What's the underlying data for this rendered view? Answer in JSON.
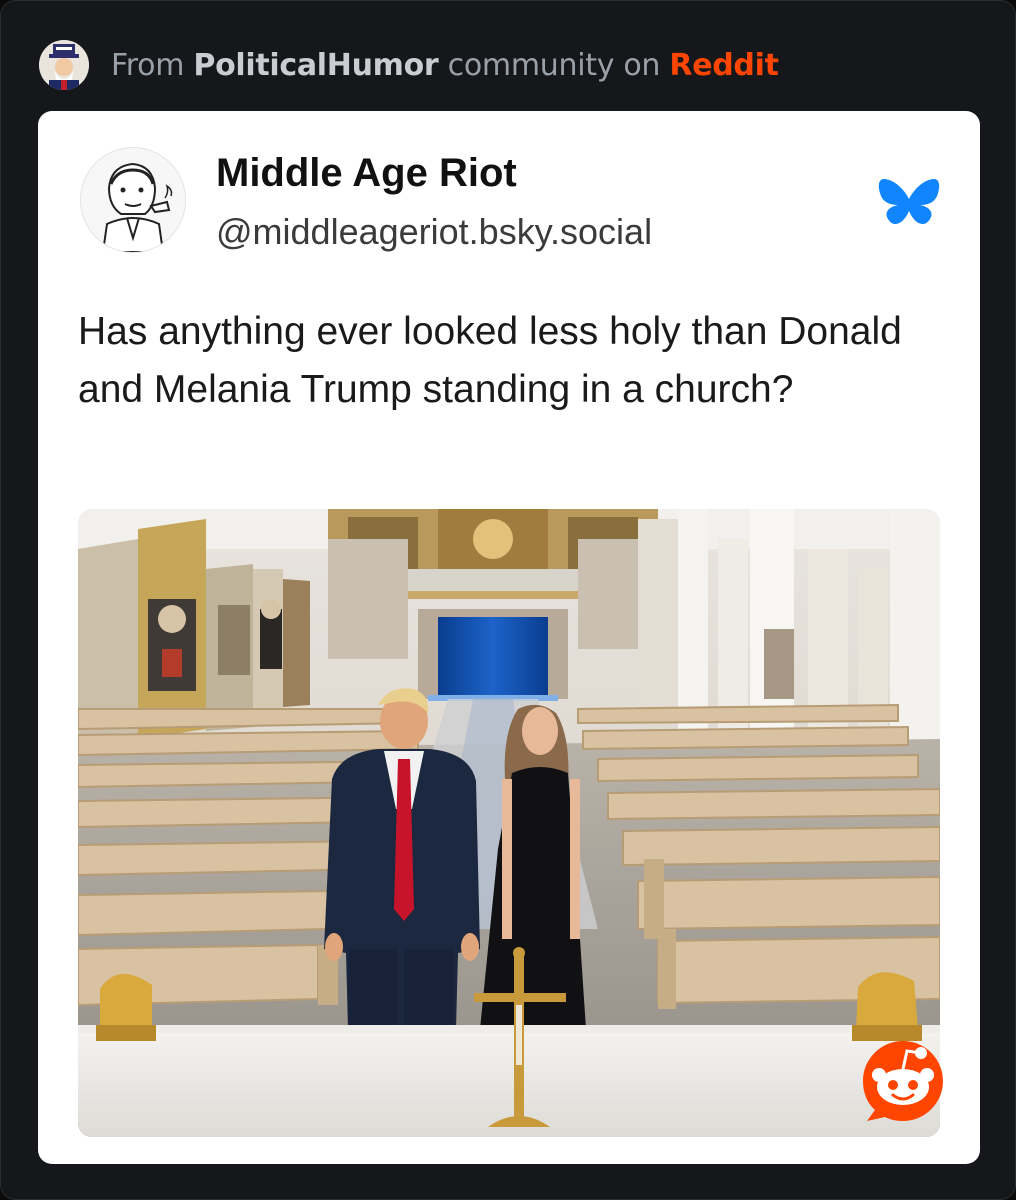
{
  "header": {
    "prefix": "From",
    "community": "PoliticalHumor",
    "middle": "community on",
    "brand": "Reddit",
    "brand_color": "#ff4500",
    "community_icon": "community-avatar-icon"
  },
  "post": {
    "author_name": "Middle Age Riot",
    "author_handle": "@middleageriot.bsky.social",
    "platform_icon": "bluesky-butterfly-icon",
    "platform_color": "#1185fe",
    "text": "Has anything ever looked less holy than Donald and Melania Trump standing in a church?",
    "image_icon": "church-photo-image"
  },
  "badge": {
    "icon": "reddit-snoo-icon",
    "color": "#ff4500"
  }
}
